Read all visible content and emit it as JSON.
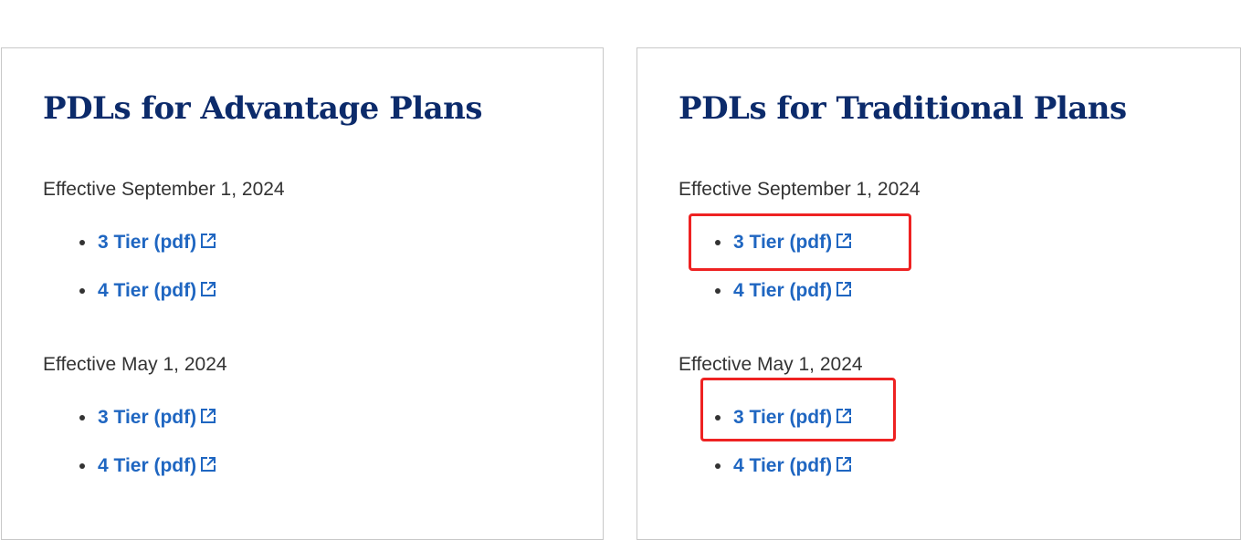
{
  "cards": [
    {
      "title": "PDLs for Advantage Plans",
      "groups": [
        {
          "label": "Effective September 1, 2024",
          "links": [
            {
              "label": "3 Tier (pdf)",
              "icon": "external-link-icon"
            },
            {
              "label": "4 Tier (pdf)",
              "icon": "external-link-icon"
            }
          ]
        },
        {
          "label": "Effective May 1, 2024",
          "links": [
            {
              "label": "3 Tier (pdf)",
              "icon": "external-link-icon"
            },
            {
              "label": "4 Tier (pdf)",
              "icon": "external-link-icon"
            }
          ]
        }
      ]
    },
    {
      "title": "PDLs for Traditional Plans",
      "groups": [
        {
          "label": "Effective September 1, 2024",
          "links": [
            {
              "label": "3 Tier (pdf)",
              "icon": "external-link-icon"
            },
            {
              "label": "4 Tier (pdf)",
              "icon": "external-link-icon"
            }
          ]
        },
        {
          "label": "Effective May 1, 2024",
          "links": [
            {
              "label": "3 Tier (pdf)",
              "icon": "external-link-icon"
            },
            {
              "label": "4 Tier (pdf)",
              "icon": "external-link-icon"
            }
          ]
        }
      ]
    }
  ],
  "colors": {
    "title": "#0c2b6b",
    "link": "#1f66c1",
    "text": "#333333",
    "border": "#c8c8c8",
    "highlight": "#ee2222"
  }
}
